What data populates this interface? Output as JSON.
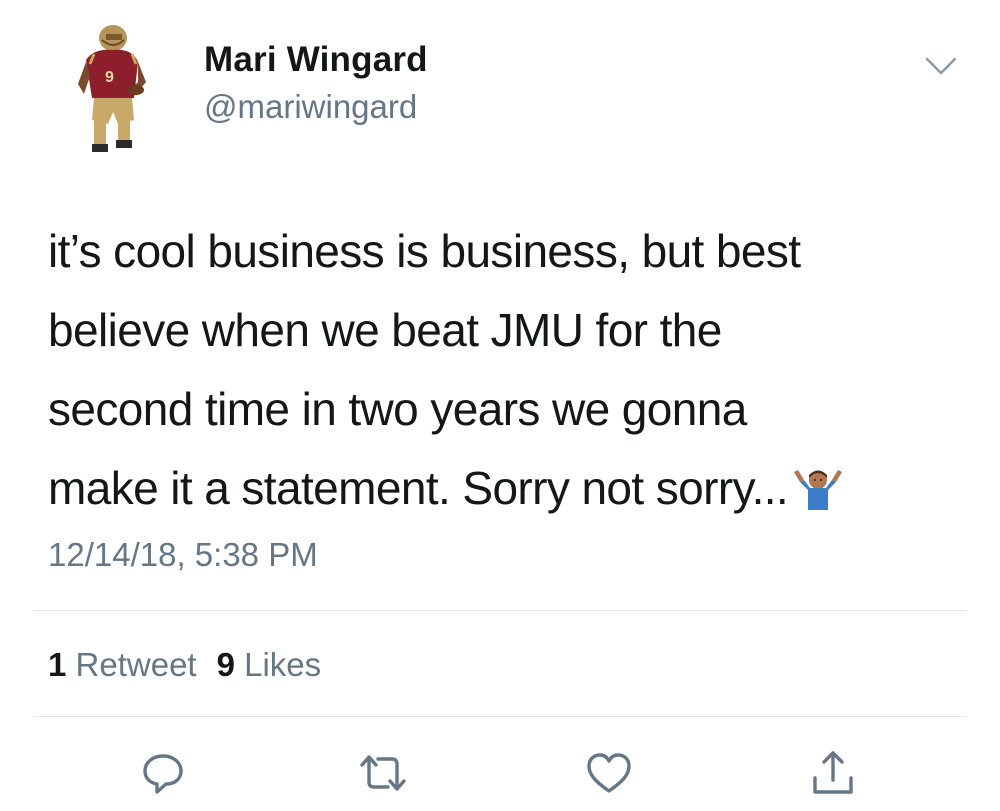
{
  "user": {
    "display_name": "Mari Wingard",
    "handle": "@mariwingard",
    "avatar_icon": "football-player-avatar"
  },
  "tweet": {
    "lines": [
      "it’s cool business is business, but best",
      "believe when we beat JMU for the",
      "second time in two years we gonna",
      "make it a statement. Sorry not sorry..."
    ],
    "trailing_emoji": "shrug-emoji",
    "timestamp": "12/14/18, 5:38 PM"
  },
  "stats": {
    "retweets_count": "1",
    "retweets_label": "Retweet",
    "likes_count": "9",
    "likes_label": "Likes"
  },
  "actions": [
    {
      "icon": "reply-icon"
    },
    {
      "icon": "retweet-icon"
    },
    {
      "icon": "like-icon"
    },
    {
      "icon": "share-icon"
    }
  ],
  "colors": {
    "text_primary": "#14171a",
    "text_secondary": "#657786",
    "divider": "#e1e8ed",
    "icon": "#657786"
  }
}
